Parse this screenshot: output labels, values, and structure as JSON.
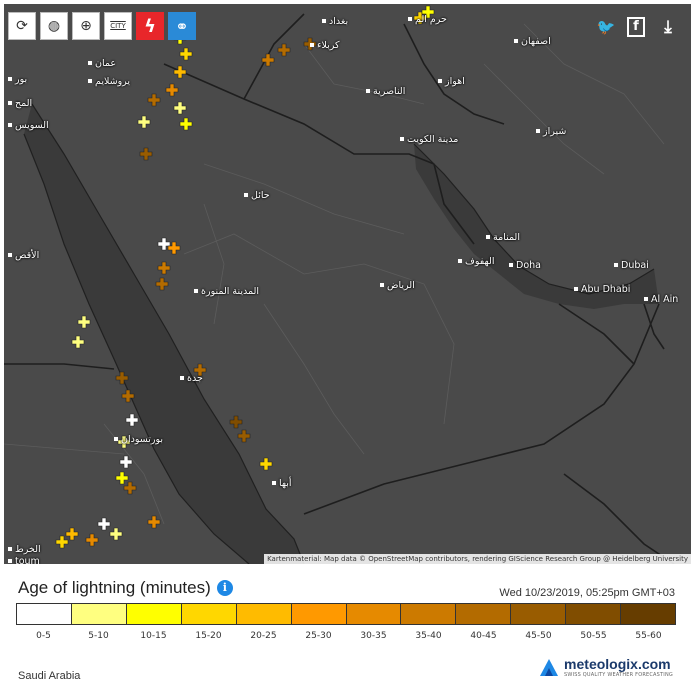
{
  "toolbar": {
    "buttons": [
      {
        "id": "refresh",
        "icon": "refresh-icon",
        "glyph": "⟳"
      },
      {
        "id": "globe",
        "icon": "globe-icon",
        "glyph": "◍"
      },
      {
        "id": "zoom",
        "icon": "zoom-icon",
        "glyph": "⊕"
      },
      {
        "id": "city",
        "icon": "city-icon",
        "label": "CITY"
      },
      {
        "id": "lightning",
        "icon": "lightning-icon",
        "glyph": "ϟ"
      },
      {
        "id": "link",
        "icon": "link-icon",
        "glyph": "⚭"
      }
    ],
    "share": [
      {
        "id": "twitter",
        "icon": "twitter-icon",
        "glyph": "🐦"
      },
      {
        "id": "facebook",
        "icon": "facebook-icon",
        "glyph": "f"
      },
      {
        "id": "download",
        "icon": "download-icon",
        "glyph": "⤓"
      }
    ]
  },
  "map": {
    "attribution": "Kartenmaterial: Map data © OpenStreetMap contributors, rendering GIScience Research Group @ Heidelberg University",
    "cities": [
      {
        "name": "بغداد"
      },
      {
        "name": "حرم الم"
      },
      {
        "name": "كربلاء"
      },
      {
        "name": "اصفهان"
      },
      {
        "name": "عمان"
      },
      {
        "name": "يروشلايم"
      },
      {
        "name": "الناصرية"
      },
      {
        "name": "اهواز"
      },
      {
        "name": "مدينة الكويت"
      },
      {
        "name": "شيراز"
      },
      {
        "name": "السويس"
      },
      {
        "name": "المح"
      },
      {
        "name": "حائل"
      },
      {
        "name": "المنامة"
      },
      {
        "name": "الهفوف"
      },
      {
        "name": "Doha"
      },
      {
        "name": "Dubai"
      },
      {
        "name": "Abu Dhabi"
      },
      {
        "name": "Al Ain"
      },
      {
        "name": "المدينة المنورة"
      },
      {
        "name": "الرياض"
      },
      {
        "name": "جدة"
      },
      {
        "name": "بورتسودان"
      },
      {
        "name": "أبها"
      },
      {
        "name": "الأقص"
      },
      {
        "name": "الخرط"
      },
      {
        "name": "toum"
      },
      {
        "name": "بور"
      }
    ]
  },
  "legend": {
    "title": "Age of lightning (minutes)",
    "timestamp": "Wed 10/23/2019, 05:25pm GMT+03",
    "swatches": [
      {
        "label": "0-5",
        "color": "#ffffff"
      },
      {
        "label": "5-10",
        "color": "#ffff80"
      },
      {
        "label": "10-15",
        "color": "#ffff00"
      },
      {
        "label": "15-20",
        "color": "#ffd700"
      },
      {
        "label": "20-25",
        "color": "#ffbb00"
      },
      {
        "label": "25-30",
        "color": "#ff9900"
      },
      {
        "label": "30-35",
        "color": "#e68a00"
      },
      {
        "label": "35-40",
        "color": "#cc7a00"
      },
      {
        "label": "40-45",
        "color": "#b36b00"
      },
      {
        "label": "45-50",
        "color": "#995c00"
      },
      {
        "label": "50-55",
        "color": "#804d00"
      },
      {
        "label": "55-60",
        "color": "#663d00"
      }
    ]
  },
  "footer": {
    "region": "Saudi Arabia",
    "brand": "meteologix.com",
    "brand_tag": "SWISS QUALITY WEATHER FORECASTING"
  }
}
